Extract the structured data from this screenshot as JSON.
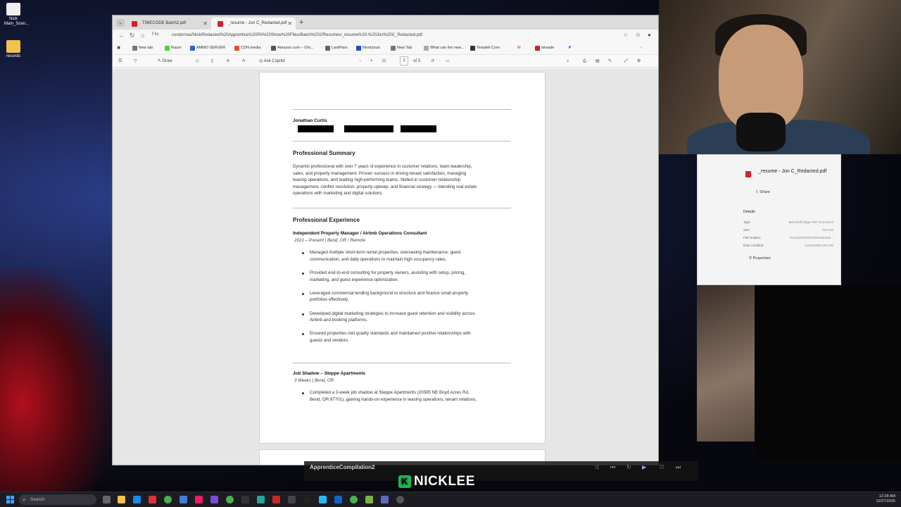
{
  "desktop": {
    "icons": [
      {
        "label": "Nick\nMain_Scen..."
      },
      {
        "label": "records"
      }
    ]
  },
  "browser": {
    "tabs": [
      {
        "label": "TIMECODE Batch2.pdf"
      },
      {
        "label": "_resume - Jon C_Redacted.pdf"
      }
    ],
    "new_tab_label": "+",
    "address_prefix": "File",
    "url": "condornas/Nick/Redacted%20Apprentice%20PA%20Show%20Files/Batch%202/Resumes/_resume%20-%20Jon%20C_Redacted.pdf",
    "favorites": [
      "New tab",
      "Razer",
      "AMMO SERVER",
      "CDN media",
      "Amazon.com – Onl...",
      "LastPass",
      "Nextcloud",
      "New Tab",
      "What can the new...",
      "Teradek Core",
      "streade"
    ],
    "pdf_toolbar": {
      "draw_label": "Draw",
      "copilot_label": "Ask Copilot",
      "page_current": "1",
      "page_total": "of 3"
    }
  },
  "resume": {
    "name": "Jonathan Curtis",
    "summary_heading": "Professional Summary",
    "summary_lines": [
      "Dynamic professional with over 7 years of experience in customer relations, team leadership,",
      "sales, and property management. Proven success in driving tenant satisfaction, managing",
      "leasing operations, and leading high-performing teams. Skilled in customer relationship",
      "management, conflict resolution, property upkeep, and financial strategy — blending real estate",
      "operations with marketing and digital solutions."
    ],
    "experience_heading": "Professional Experience",
    "jobs": [
      {
        "title": "Independent Property Manager / Airbnb Operations Consultant",
        "when": "2021 – Present | Bend, OR / Remote",
        "bullets": [
          [
            "Managed multiple short-term rental properties, overseeing maintenance, guest",
            "communication, and daily operations to maintain high occupancy rates."
          ],
          [
            "Provided end-to-end consulting for property owners, assisting with setup, pricing,",
            "marketing, and guest experience optimization."
          ],
          [
            "Leveraged commercial lending background to structure and finance small property",
            "portfolios effectively."
          ],
          [
            "Developed digital marketing strategies to increase guest retention and visibility across",
            "Airbnb and booking platforms."
          ],
          [
            "Ensured properties met quality standards and maintained positive relationships with",
            "guests and vendors."
          ]
        ]
      },
      {
        "title": "Job Shadow – Steppe Apartments",
        "when": "3 Weeks | Bend, OR",
        "bullets": [
          [
            "Completed a 3-week job shadow at Steppe Apartments (20585 NE Boyd Acres Rd,",
            "Bend, OR 97701), gaining hands-on experience in leasing operations, tenant relations,"
          ]
        ]
      }
    ]
  },
  "properties_panel": {
    "file_name": "_resume - Jon C_Redacted.pdf",
    "share_label": "Share",
    "details_label": "Details",
    "rows": [
      {
        "key": "Type",
        "value": "Microsoft Edge PDF Document"
      },
      {
        "key": "Size",
        "value": "75.5 KB"
      },
      {
        "key": "File location",
        "value": "\\\\CondorNAS\\Nick\\Redacted..."
      },
      {
        "key": "Date modified",
        "value": "12/23/2025 5:04 AM"
      }
    ],
    "properties_label": "Properties"
  },
  "media_bar": {
    "title": "ApprenticeCompilation2"
  },
  "brand": {
    "logo_letter": "K",
    "text": "NICKLEE"
  },
  "taskbar": {
    "search_placeholder": "Search",
    "time": "12:28 AM",
    "date": "12/27/2025"
  },
  "colors": {
    "pdf_red": "#d4202f",
    "accent_blue": "#3ea6ff",
    "brand_green": "#1db954"
  }
}
